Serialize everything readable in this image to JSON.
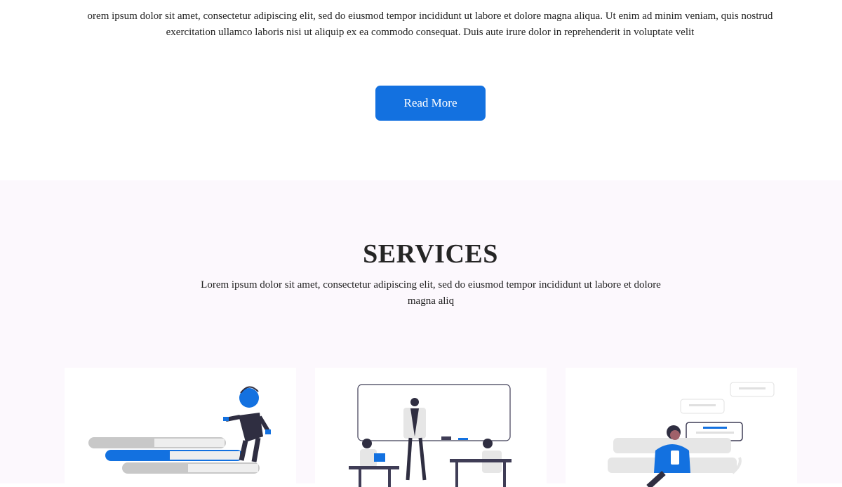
{
  "about": {
    "paragraph": "orem ipsum dolor sit amet, consectetur adipiscing elit, sed do eiusmod tempor incididunt ut labore et dolore magna aliqua. Ut enim ad minim veniam, quis nostrud exercitation ullamco laboris nisi ut aliquip ex ea commodo consequat. Duis aute irure dolor in reprehenderit in voluptate velit",
    "read_more_label": "Read More"
  },
  "services": {
    "title": "SERVICES",
    "subtitle": "Lorem ipsum dolor sit amet, consectetur adipiscing elit, sed do eiusmod tempor incididunt ut labore et dolore magna aliq",
    "cards": [
      {
        "illustration": "person-climbing-books-illustration"
      },
      {
        "illustration": "classroom-whiteboard-illustration"
      },
      {
        "illustration": "person-with-phone-chat-illustration"
      }
    ]
  },
  "colors": {
    "accent": "#1371e0",
    "services_background": "#fcf8fd",
    "card_background": "#ffffff",
    "text": "#222222"
  }
}
